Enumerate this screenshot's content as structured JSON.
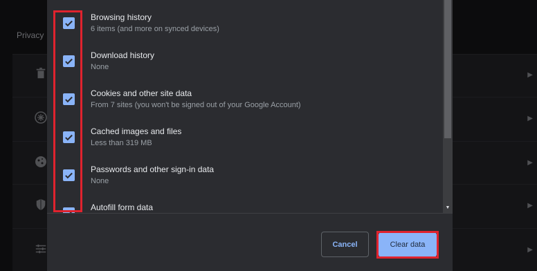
{
  "background": {
    "section_label": "Privacy",
    "rows": [
      {
        "icon": "trash-icon"
      },
      {
        "icon": "cookie-settings-icon"
      },
      {
        "icon": "cookie-icon"
      },
      {
        "icon": "shield-icon"
      },
      {
        "icon": "sliders-icon"
      }
    ]
  },
  "dialog": {
    "items": [
      {
        "title": "Browsing history",
        "subtitle": "6 items (and more on synced devices)",
        "checked": true
      },
      {
        "title": "Download history",
        "subtitle": "None",
        "checked": true
      },
      {
        "title": "Cookies and other site data",
        "subtitle": "From 7 sites (you won't be signed out of your Google Account)",
        "checked": true
      },
      {
        "title": "Cached images and files",
        "subtitle": "Less than 319 MB",
        "checked": true
      },
      {
        "title": "Passwords and other sign-in data",
        "subtitle": "None",
        "checked": true
      },
      {
        "title": "Autofill form data",
        "subtitle": "",
        "checked": true
      }
    ],
    "cancel_label": "Cancel",
    "clear_label": "Clear data"
  },
  "colors": {
    "accent": "#8ab4f8",
    "dialog_bg": "#2b2c30",
    "highlight": "#e0232e"
  }
}
